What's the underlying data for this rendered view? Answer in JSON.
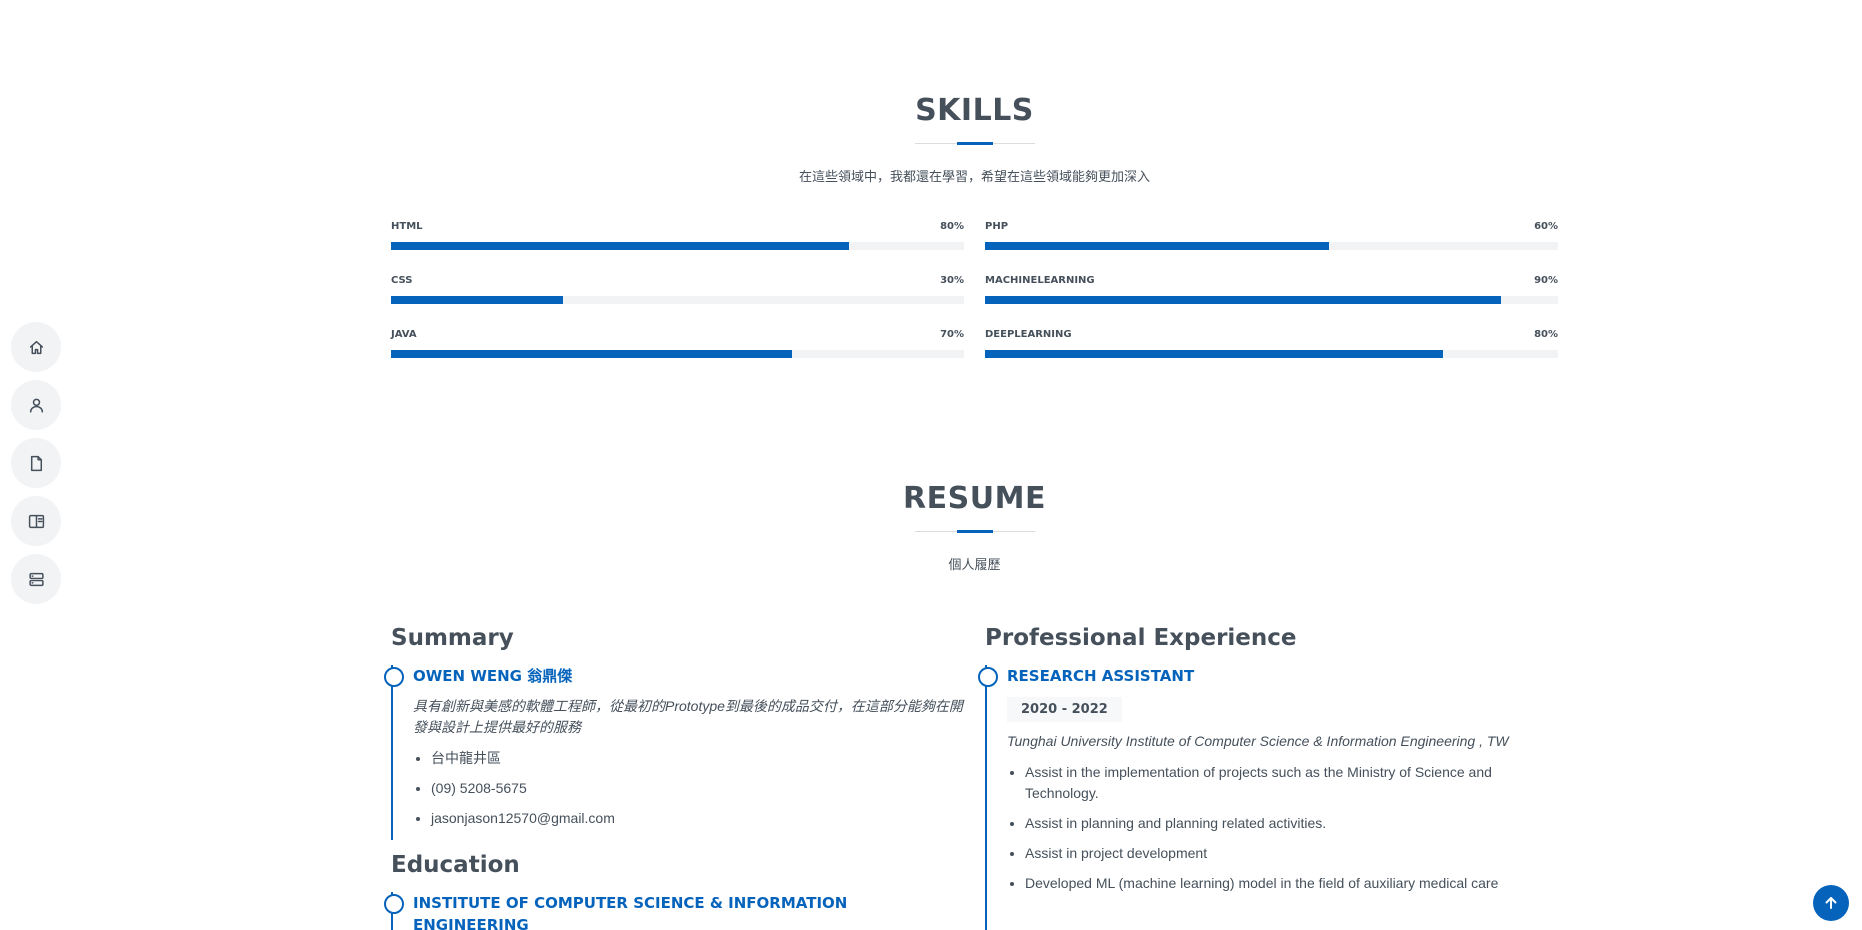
{
  "nav": {
    "items": [
      {
        "icon": "home-icon"
      },
      {
        "icon": "person-icon"
      },
      {
        "icon": "file-icon"
      },
      {
        "icon": "book-icon"
      },
      {
        "icon": "server-icon"
      }
    ]
  },
  "skills": {
    "title": "SKILLS",
    "subtitle": "在這些領域中，我都還在學習，希望在這些領域能夠更加深入",
    "left": [
      {
        "name": "HTML",
        "percent_label": "80%",
        "value": 80
      },
      {
        "name": "CSS",
        "percent_label": "30%",
        "value": 30
      },
      {
        "name": "JAVA",
        "percent_label": "70%",
        "value": 70
      }
    ],
    "right": [
      {
        "name": "PHP",
        "percent_label": "60%",
        "value": 60
      },
      {
        "name": "MACHINELEARNING",
        "percent_label": "90%",
        "value": 90
      },
      {
        "name": "DEEPLEARNING",
        "percent_label": "80%",
        "value": 80
      }
    ]
  },
  "resume": {
    "title": "RESUME",
    "subtitle": "個人履歷",
    "summary": {
      "heading": "Summary",
      "name": "OWEN WENG 翁鼎傑",
      "description": "具有創新與美感的軟體工程師，從最初的Prototype到最後的成品交付，在這部分能夠在開發與設計上提供最好的服務",
      "details": [
        "台中龍井區",
        "(09) 5208-5675",
        "jasonjason12570@gmail.com"
      ]
    },
    "education": {
      "heading": "Education",
      "school": "INSTITUTE OF COMPUTER SCIENCE & INFORMATION ENGINEERING"
    },
    "experience": {
      "heading": "Professional Experience",
      "role": "RESEARCH ASSISTANT",
      "years": "2020 - 2022",
      "org": "Tunghai University Institute of Computer Science & Information Engineering , TW",
      "duties": [
        "Assist in the implementation of projects such as the Ministry of Science and Technology.",
        "Assist in planning and planning related activities.",
        "Assist in project development",
        "Developed ML (machine learning) model in the field of auxiliary medical care"
      ]
    }
  },
  "colors": {
    "accent": "#0563bb",
    "text": "#45505b",
    "track": "#f2f3f5"
  }
}
